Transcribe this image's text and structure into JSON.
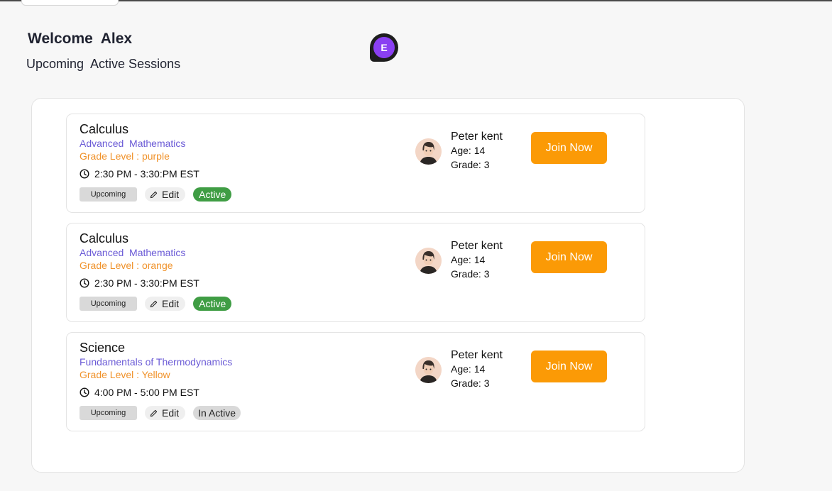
{
  "header": {
    "welcome": "Welcome  Alex",
    "subtitle": "Upcoming  Active Sessions",
    "avatar_initial": "E",
    "avatar_color": "#8a3ff2"
  },
  "colors": {
    "join_button": "#fb9a06",
    "course_text": "#6b5bd6",
    "grade_text": "#f0922a",
    "active_badge": "#3f9d44"
  },
  "sessions": [
    {
      "subject": "Calculus",
      "course": "Advanced  Mathematics",
      "grade_level": "Grade Level : purple",
      "time": "2:30 PM - 3:30:PM EST",
      "upcoming_label": "Upcoming",
      "edit_label": "Edit",
      "status": "Active",
      "student": {
        "name": "Peter kent",
        "age": "Age: 14",
        "grade": "Grade: 3"
      },
      "join_label": "Join Now"
    },
    {
      "subject": "Calculus",
      "course": "Advanced  Mathematics",
      "grade_level": "Grade Level : orange",
      "time": "2:30 PM - 3:30:PM EST",
      "upcoming_label": "Upcoming",
      "edit_label": "Edit",
      "status": "Active",
      "student": {
        "name": "Peter kent",
        "age": "Age: 14",
        "grade": "Grade: 3"
      },
      "join_label": "Join Now"
    },
    {
      "subject": "Science",
      "course": "Fundamentals of Thermodynamics",
      "grade_level": "Grade Level : Yellow",
      "time": "4:00 PM - 5:00 PM EST",
      "upcoming_label": "Upcoming",
      "edit_label": "Edit",
      "status": "In Active",
      "student": {
        "name": "Peter kent",
        "age": "Age: 14",
        "grade": "Grade: 3"
      },
      "join_label": "Join Now"
    }
  ]
}
